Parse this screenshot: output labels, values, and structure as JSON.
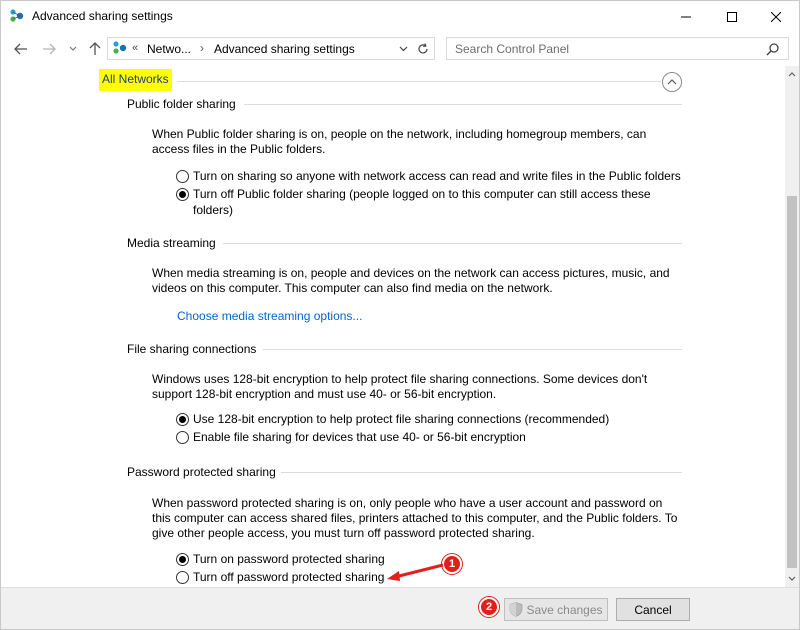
{
  "window": {
    "title": "Advanced sharing settings"
  },
  "address_bar": {
    "chevron": "«",
    "segment1": "Netwo...",
    "separator": "›",
    "segment2": "Advanced sharing settings"
  },
  "search": {
    "placeholder": "Search Control Panel"
  },
  "group": {
    "title": "All Networks"
  },
  "sections": {
    "public_folder": {
      "title": "Public folder sharing",
      "description": "When Public folder sharing is on, people on the network, including homegroup members, can access files in the Public folders.",
      "option_on": "Turn on sharing so anyone with network access can read and write files in the Public folders",
      "option_off": "Turn off Public folder sharing (people logged on to this computer can still access these folders)",
      "selected": "off"
    },
    "media_streaming": {
      "title": "Media streaming",
      "description": "When media streaming is on, people and devices on the network can access pictures, music, and videos on this computer. This computer can also find media on the network.",
      "link": "Choose media streaming options..."
    },
    "file_sharing": {
      "title": "File sharing connections",
      "description": "Windows uses 128-bit encryption to help protect file sharing connections. Some devices don't support 128-bit encryption and must use 40- or 56-bit encryption.",
      "option_128": "Use 128-bit encryption to help protect file sharing connections (recommended)",
      "option_40_56": "Enable file sharing for devices that use 40- or 56-bit encryption",
      "selected": "128"
    },
    "password_sharing": {
      "title": "Password protected sharing",
      "description": "When password protected sharing is on, only people who have a user account and password on this computer can access shared files, printers attached to this computer, and the Public folders. To give other people access, you must turn off password protected sharing.",
      "option_on": "Turn on password protected sharing",
      "option_off": "Turn off password protected sharing",
      "selected": "on"
    }
  },
  "buttons": {
    "save": "Save changes",
    "cancel": "Cancel"
  },
  "annotations": {
    "step1": "1",
    "step2": "2",
    "color": "#e0201b"
  }
}
